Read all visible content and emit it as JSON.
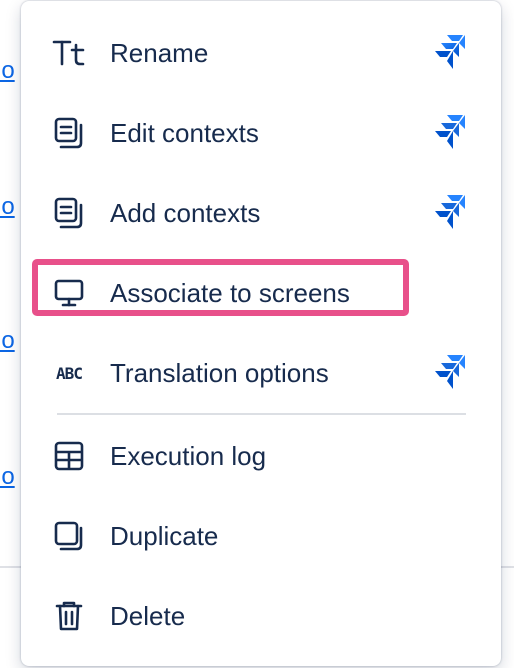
{
  "background": {
    "link_fragment": "io"
  },
  "menu": {
    "items": [
      {
        "label": "Rename",
        "icon": "text-size-icon",
        "has_brand": true
      },
      {
        "label": "Edit contexts",
        "icon": "contexts-icon",
        "has_brand": true
      },
      {
        "label": "Add contexts",
        "icon": "contexts-icon",
        "has_brand": true
      },
      {
        "label": "Associate to screens",
        "icon": "screen-icon",
        "has_brand": false,
        "highlighted": true
      },
      {
        "label": "Translation options",
        "icon": "abc-icon",
        "icon_text": "ABC",
        "has_brand": true
      },
      {
        "label": "Execution log",
        "icon": "table-icon",
        "has_brand": false
      },
      {
        "label": "Duplicate",
        "icon": "duplicate-icon",
        "has_brand": false
      },
      {
        "label": "Delete",
        "icon": "trash-icon",
        "has_brand": false
      }
    ]
  },
  "colors": {
    "text": "#172b4d",
    "link": "#0c66e4",
    "highlight": "#e8508a",
    "brand_dark": "#2684ff",
    "brand_light": "#0052cc"
  }
}
